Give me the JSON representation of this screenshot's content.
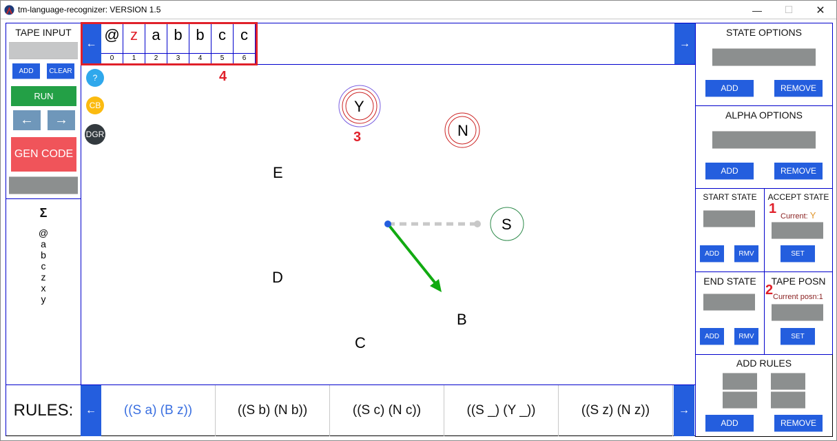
{
  "window": {
    "title": "tm-language-recognizer: VERSION 1.5",
    "controls": {
      "minimize": "—",
      "maximize": "☐",
      "close": "✕"
    }
  },
  "left_panel": {
    "tape_input_title": "TAPE INPUT",
    "tape_input_value": "",
    "add_label": "ADD",
    "clear_label": "CLEAR",
    "run_label": "RUN",
    "step_back_icon": "←",
    "step_forward_icon": "→",
    "gen_code_label": "GEN CODE",
    "gen_code_output": "",
    "alphabet_title": "Σ",
    "alphabet": [
      "@",
      "a",
      "b",
      "c",
      "z",
      "x",
      "y"
    ]
  },
  "tape": {
    "scroll_left_icon": "←",
    "scroll_right_icon": "→",
    "cells": [
      {
        "symbol": "@",
        "index": "0"
      },
      {
        "symbol": "z",
        "index": "1",
        "highlight": true
      },
      {
        "symbol": "a",
        "index": "2"
      },
      {
        "symbol": "b",
        "index": "3"
      },
      {
        "symbol": "b",
        "index": "4"
      },
      {
        "symbol": "c",
        "index": "5"
      },
      {
        "symbol": "c",
        "index": "6"
      }
    ],
    "highlight_color": "#e0202a",
    "annotation": "4"
  },
  "canvas_tools": {
    "help_label": "?",
    "cb_label": "CB",
    "dgr_label": "DGR"
  },
  "graph": {
    "nodes": [
      {
        "id": "Y",
        "label": "Y",
        "type": "accept-current",
        "annotation": "3"
      },
      {
        "id": "N",
        "label": "N",
        "type": "end"
      },
      {
        "id": "S",
        "label": "S",
        "type": "start"
      },
      {
        "id": "E",
        "label": "E",
        "type": "plain"
      },
      {
        "id": "D",
        "label": "D",
        "type": "plain"
      },
      {
        "id": "C",
        "label": "C",
        "type": "plain"
      },
      {
        "id": "B",
        "label": "B",
        "type": "plain"
      }
    ],
    "transition_from": "S",
    "transition_to": "B",
    "colors": {
      "arrow": "#11aa11",
      "dashed": "#c8c8c8",
      "head": "#245ede",
      "accept_outer": "#7a5fe0",
      "end_ring": "#cc2222",
      "start_ring": "#2d8a4a"
    }
  },
  "rules_bar": {
    "label": "RULES:",
    "scroll_left_icon": "←",
    "scroll_right_icon": "→",
    "rules": [
      {
        "text": "((S a) (B z))",
        "active": true
      },
      {
        "text": "((S b) (N b))"
      },
      {
        "text": "((S c) (N c))"
      },
      {
        "text": "((S _) (Y _))"
      },
      {
        "text": "((S z) (N z))"
      }
    ],
    "active_color": "#3a6fe0"
  },
  "right_panel": {
    "state_options": {
      "title": "STATE OPTIONS",
      "value": "",
      "add_label": "ADD",
      "remove_label": "REMOVE"
    },
    "alpha_options": {
      "title": "ALPHA OPTIONS",
      "value": "",
      "add_label": "ADD",
      "remove_label": "REMOVE"
    },
    "start_state": {
      "title": "START STATE",
      "value": "",
      "add_label": "ADD",
      "remove_label": "RMV"
    },
    "accept_state": {
      "title": "ACCEPT STATE",
      "current_prefix": "Current: ",
      "current_value": "Y",
      "value": "",
      "set_label": "SET",
      "annotation": "1"
    },
    "end_state": {
      "title": "END STATE",
      "value": "",
      "add_label": "ADD",
      "remove_label": "RMV"
    },
    "tape_posn": {
      "title": "TAPE POSN",
      "current_text": "Current posn:1",
      "value": "",
      "set_label": "SET",
      "annotation": "2"
    },
    "add_rules": {
      "title": "ADD RULES",
      "add_label": "ADD",
      "remove_label": "REMOVE"
    }
  }
}
